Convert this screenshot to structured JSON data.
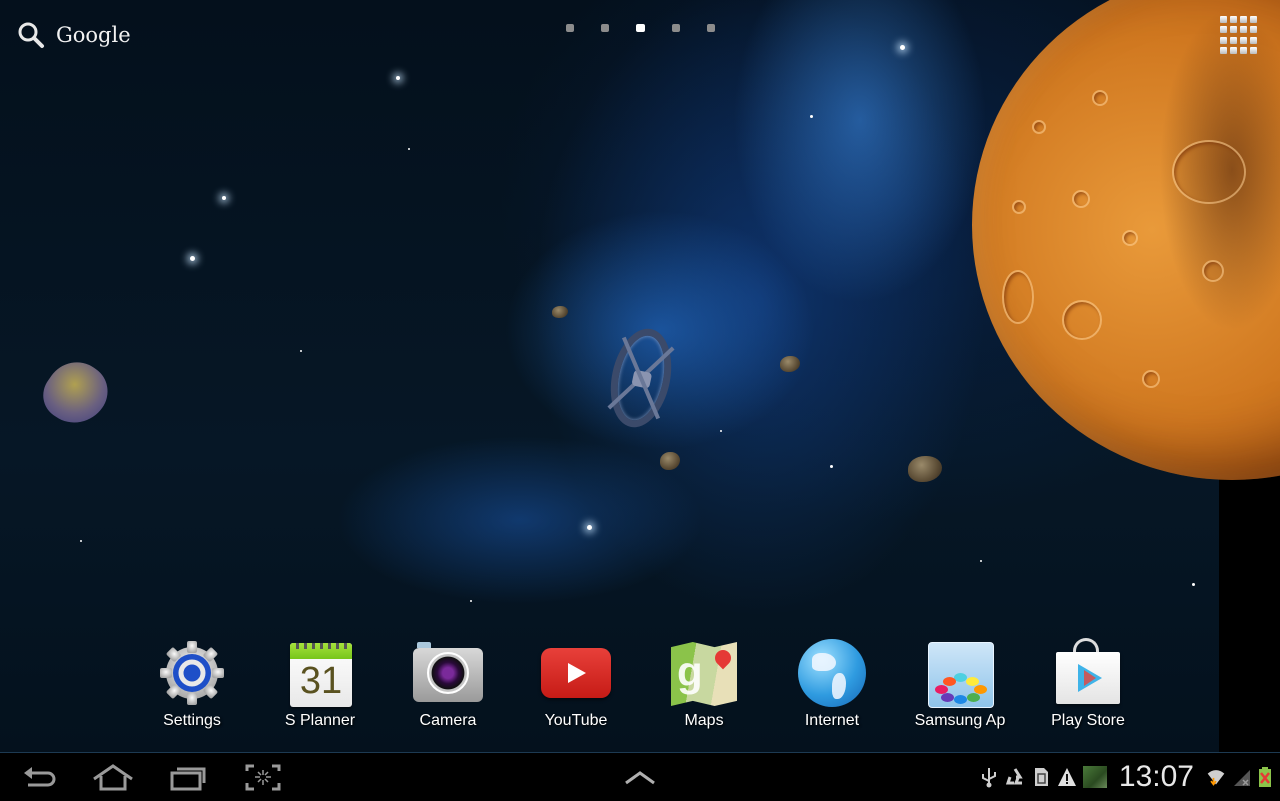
{
  "search_widget": {
    "label": "Google",
    "icon": "search-icon"
  },
  "page_indicator": {
    "pages": 5,
    "current_page": 3
  },
  "apps_button": {
    "icon": "apps-grid-icon"
  },
  "dock": {
    "apps": [
      {
        "name": "Settings",
        "icon": "settings-gear-icon"
      },
      {
        "name": "S Planner",
        "icon": "calendar-icon",
        "icon_text": "31"
      },
      {
        "name": "Camera",
        "icon": "camera-icon"
      },
      {
        "name": "YouTube",
        "icon": "youtube-icon"
      },
      {
        "name": "Maps",
        "icon": "maps-icon"
      },
      {
        "name": "Internet",
        "icon": "globe-icon"
      },
      {
        "name": "Samsung Ap",
        "icon": "samsung-apps-icon"
      },
      {
        "name": "Play Store",
        "icon": "play-store-icon"
      }
    ]
  },
  "navbar": {
    "buttons": [
      "back",
      "home",
      "recent-apps",
      "screenshot"
    ],
    "center": "app-tray-up"
  },
  "status_bar": {
    "time": "13:07",
    "icons": [
      "usb-icon",
      "recycle-icon",
      "sd-card-icon",
      "warning-icon",
      "image-notification-icon",
      "wifi-icon",
      "signal-icon",
      "battery-icon"
    ],
    "battery_color": "#8bc34a",
    "battery_error_color": "#e53935"
  },
  "colors": {
    "planet": "#d07820",
    "dock_label": "#ffffff",
    "nav_icon": "#9a9a9a"
  }
}
